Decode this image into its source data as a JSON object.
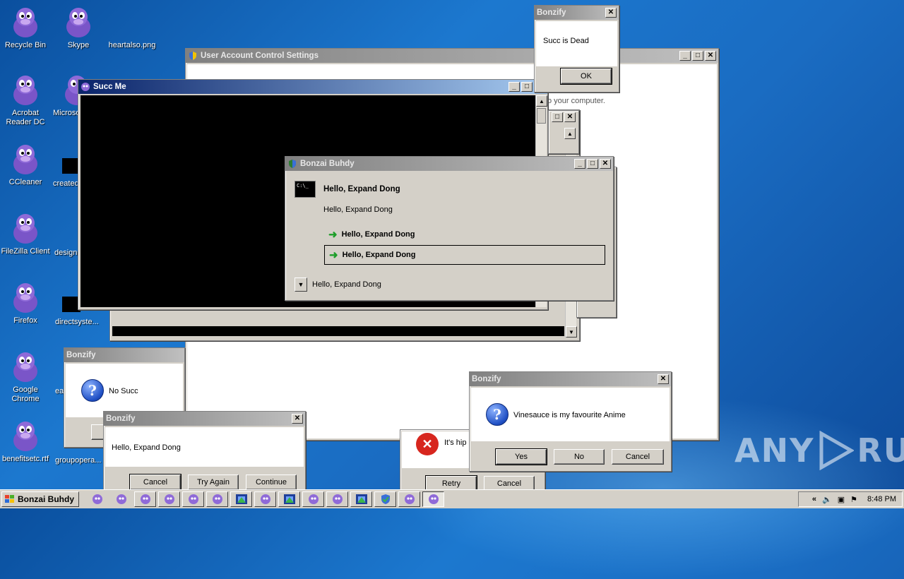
{
  "desktop": {
    "icons": [
      {
        "label": "Recycle Bin"
      },
      {
        "label": "Skype"
      },
      {
        "label": "heartalso.png"
      },
      {
        "label": "Acrobat Reader DC"
      },
      {
        "label": "Microso"
      },
      {
        "label": "CCleaner"
      },
      {
        "label": "created"
      },
      {
        "label": "FileZilla Client"
      },
      {
        "label": "design"
      },
      {
        "label": "Firefox"
      },
      {
        "label": "directsyste..."
      },
      {
        "label": "Google Chrome"
      },
      {
        "label": "ea"
      },
      {
        "label": "benefitsetc.rtf"
      },
      {
        "label": "groupopera..."
      }
    ],
    "watermark": {
      "left": "ANY",
      "right": "RUN"
    }
  },
  "uac_window": {
    "title": "User Account Control Settings",
    "partial_text": "o your computer."
  },
  "succ_me_window": {
    "title": "Succ Me"
  },
  "bonzify_dead": {
    "title": "Bonzify",
    "message": "Succ is Dead",
    "ok_label": "OK"
  },
  "bonzai_buhdy": {
    "title": "Bonzai Buhdy",
    "heading": "Hello, Expand Dong",
    "body": "Hello, Expand Dong",
    "option1": "Hello, Expand Dong",
    "option2": "Hello, Expand Dong",
    "footer": "Hello, Expand Dong",
    "console_icon_text": "C:\\_"
  },
  "bonzify_nosucc": {
    "title": "Bonzify",
    "message": "No Succ"
  },
  "bonzify_hello": {
    "title": "Bonzify",
    "message": "Hello, Expand Dong",
    "cancel_label": "Cancel",
    "try_again_label": "Try Again",
    "continue_label": "Continue"
  },
  "error_dialog": {
    "partial_text": "It's hip",
    "retry_label": "Retry",
    "cancel_label": "Cancel"
  },
  "bonzify_anime": {
    "title": "Bonzify",
    "message": "Vinesauce is my favourite Anime",
    "yes_label": "Yes",
    "no_label": "No",
    "cancel_label": "Cancel"
  },
  "taskbar": {
    "start_label": "Bonzai Buhdy",
    "clock": "8:48 PM",
    "tray_chevron": "«"
  },
  "colors": {
    "titlebar_active_start": "#0a246a",
    "titlebar_active_end": "#a6caf0",
    "titlebar_inactive_start": "#808080",
    "desktop": "#1c78cf"
  }
}
